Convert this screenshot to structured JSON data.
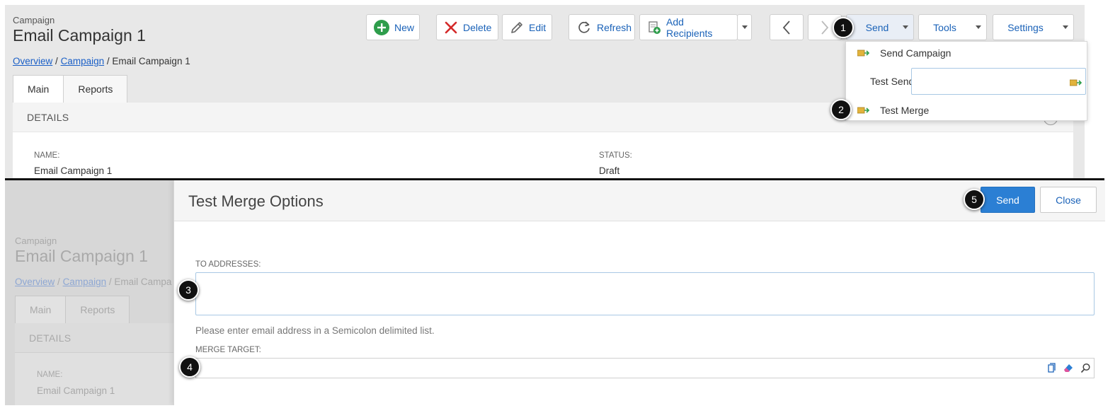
{
  "top": {
    "header_sub": "Campaign",
    "header_title": "Email Campaign 1",
    "breadcrumb": {
      "overview": "Overview",
      "campaign": "Campaign",
      "current": "Email Campaign 1",
      "sep": "/"
    },
    "tabs": [
      {
        "label": "Main"
      },
      {
        "label": "Reports"
      }
    ],
    "details_label": "DETAILS",
    "fields": {
      "name_label": "NAME:",
      "name_value": "Email Campaign 1",
      "status_label": "STATUS:",
      "status_value": "Draft"
    },
    "toolbar": {
      "new": "New",
      "delete": "Delete",
      "edit": "Edit",
      "refresh": "Refresh",
      "add_recipients": "Add Recipients",
      "send": "Send",
      "tools": "Tools",
      "settings": "Settings"
    },
    "send_menu": {
      "send_campaign": "Send Campaign",
      "test_send": "Test Send",
      "test_send_value": "",
      "test_merge": "Test Merge"
    }
  },
  "bottom": {
    "faded": {
      "header_sub": "Campaign",
      "header_title": "Email Campaign 1",
      "breadcrumb": {
        "overview": "Overview",
        "campaign": "Campaign",
        "current": "Email Campa",
        "sep": "/"
      },
      "tabs": [
        {
          "label": "Main"
        },
        {
          "label": "Reports"
        }
      ],
      "details_label": "DETAILS",
      "name_label": "NAME:",
      "name_value": "Email Campaign 1"
    },
    "modal": {
      "title": "Test Merge Options",
      "send_label": "Send",
      "close_label": "Close",
      "to_label": "TO ADDRESSES:",
      "to_value": "",
      "hint": "Please enter email address in a Semicolon delimited list.",
      "merge_label": "MERGE TARGET:",
      "merge_value": ""
    }
  },
  "callouts": [
    "1",
    "2",
    "3",
    "4",
    "5"
  ],
  "colors": {
    "accent": "#1a62b8",
    "primary_button": "#2b7fd4",
    "new_icon": "#2e9d4b",
    "delete_icon": "#d42a2a"
  },
  "icons": {
    "new": "plus-circle-icon",
    "delete": "x-icon",
    "edit": "pencil-icon",
    "refresh": "refresh-icon",
    "add_recipients": "add-recipient-icon",
    "prev": "chevron-left-icon",
    "next": "chevron-right-icon",
    "send_item": "send-envelope-icon",
    "merge_actions": [
      "open-icon",
      "eraser-icon",
      "search-icon"
    ]
  }
}
